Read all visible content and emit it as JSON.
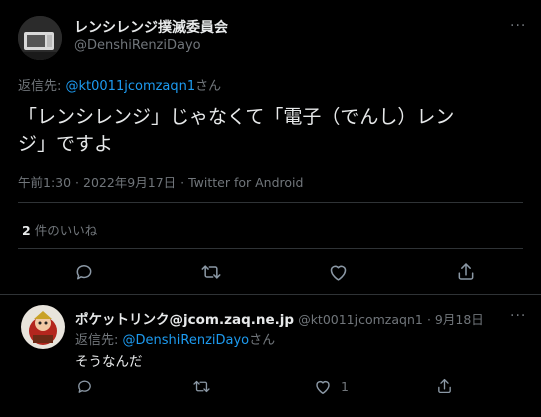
{
  "main_tweet": {
    "author_name": "レンシレンジ撲滅委員会",
    "author_handle": "@DenshiRenziDayo",
    "more_glyph": "···",
    "reply_to_prefix": "返信先: ",
    "reply_to_handle": "@kt0011jcomzaqn1",
    "reply_to_suffix": "さん",
    "text_line1": "「レンシレンジ」じゃなくて「電子（でんし）レン",
    "text_line2": "ジ」ですよ",
    "timestamp": "午前1:30 · 2022年9月17日 · Twitter for Android",
    "likes_count": "2",
    "likes_label": "件のいいね"
  },
  "reply_tweet": {
    "author_name": "ポケットリンク@jcom.zaq.ne.jp",
    "author_handle": "@kt0011jcomzaqn1",
    "date": "· 9月18日",
    "more_glyph": "···",
    "reply_to_prefix": "返信先: ",
    "reply_to_handle": "@DenshiRenziDayo",
    "reply_to_suffix": "さん",
    "text": "そうなんだ",
    "like_count": "1"
  },
  "colors": {
    "background": "#000000",
    "text": "#e7e9ea",
    "muted": "#71767b",
    "link": "#1d9bf0",
    "divider": "#2f3336"
  },
  "icons": [
    "reply-icon",
    "retweet-icon",
    "like-icon",
    "share-icon",
    "more-icon"
  ]
}
